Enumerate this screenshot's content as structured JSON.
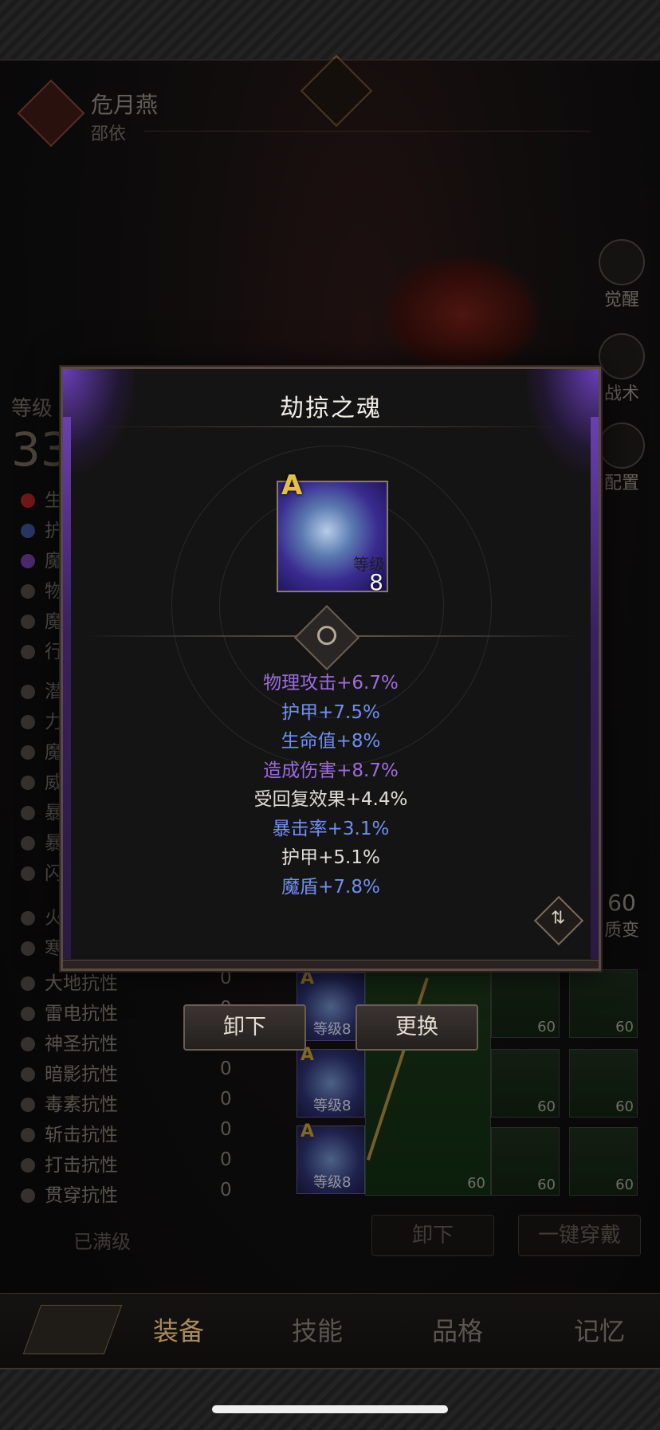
{
  "hero": {
    "name": "危月燕",
    "subtitle": "邵依"
  },
  "side_buttons": [
    {
      "label": "觉醒",
      "icon": "awaken-icon"
    },
    {
      "label": "战术",
      "icon": "tactics-icon"
    },
    {
      "label": "配置",
      "icon": "config-icon"
    }
  ],
  "side_value": {
    "number": "60",
    "label": "质变"
  },
  "level": {
    "label": "等级",
    "value": "33"
  },
  "resistances": [
    {
      "name": "大地抗性",
      "value": "0"
    },
    {
      "name": "雷电抗性",
      "value": "0"
    },
    {
      "name": "神圣抗性",
      "value": "0"
    },
    {
      "name": "暗影抗性",
      "value": "0"
    },
    {
      "name": "毒素抗性",
      "value": "0"
    },
    {
      "name": "斩击抗性",
      "value": "0"
    },
    {
      "name": "打击抗性",
      "value": "0"
    },
    {
      "name": "贯穿抗性",
      "value": "0"
    }
  ],
  "partial_stats": [
    "生",
    "护",
    "魔",
    "物",
    "魔",
    "行",
    "潜",
    "力",
    "魔",
    "威",
    "暴",
    "暴",
    "闪",
    "火",
    "寒"
  ],
  "maxed_label": "已满级",
  "soul_slots": [
    {
      "grade": "A",
      "level": "等级8"
    },
    {
      "grade": "A",
      "level": "等级8"
    },
    {
      "grade": "A",
      "level": "等级8"
    }
  ],
  "equip_levels": [
    "60",
    "60",
    "60",
    "60",
    "60",
    "60",
    "60"
  ],
  "bottom_buttons": {
    "unequip": "卸下",
    "equip_all": "一键穿戴"
  },
  "tabs": [
    "装备",
    "技能",
    "品格",
    "记忆"
  ],
  "dialog": {
    "title": "劫掠之魂",
    "item": {
      "grade": "A",
      "level_label": "等级",
      "level": "8"
    },
    "attributes": [
      {
        "text": "物理攻击+6.7%",
        "color": "#9b6de0"
      },
      {
        "text": "护甲+7.5%",
        "color": "#6f8ff0"
      },
      {
        "text": "生命值+8%",
        "color": "#6f8ff0"
      },
      {
        "text": "造成伤害+8.7%",
        "color": "#9b6de0"
      },
      {
        "text": "受回复效果+4.4%",
        "color": "#e0dcd6"
      },
      {
        "text": "暴击率+3.1%",
        "color": "#6f8ff0"
      },
      {
        "text": "护甲+5.1%",
        "color": "#e0dcd6"
      },
      {
        "text": "魔盾+7.8%",
        "color": "#6f8ff0"
      }
    ],
    "actions": {
      "unequip": "卸下",
      "replace": "更换"
    }
  }
}
